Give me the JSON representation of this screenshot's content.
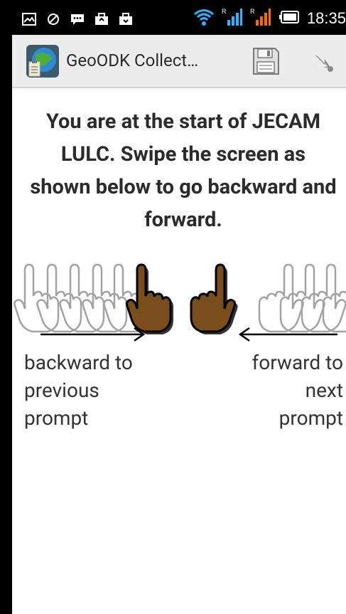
{
  "status_bar": {
    "time": "18:35",
    "icons": [
      "gallery-icon",
      "sync-icon",
      "chat-icon",
      "bag-icon",
      "bag-icon",
      "wifi-icon",
      "signal-r-icon",
      "signal-r-icon",
      "battery-icon"
    ]
  },
  "action_bar": {
    "title": "GeoODK Collect…",
    "app_icon": "globe-clipboard-icon",
    "save_icon": "floppy-disk-icon",
    "next_icon": "arrow-down-right-icon"
  },
  "main": {
    "headline": "You are at the start of JECAM LULC. Swipe the screen as shown below to go backward and forward.",
    "back_label": "backward to\nprevious\nprompt",
    "forward_label": "forward to\nnext\nprompt"
  },
  "colors": {
    "hand_fill": "#7a4e1c",
    "hand_outline": "#000000",
    "ghost_hand": "#9a9a9a"
  }
}
